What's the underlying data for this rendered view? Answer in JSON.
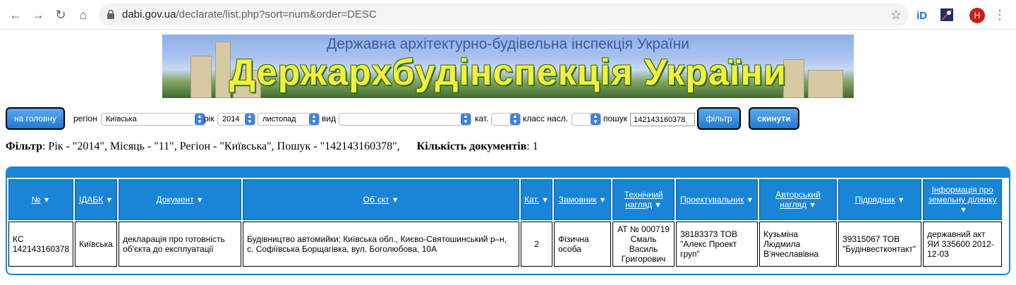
{
  "browser": {
    "url_domain": "dabi.gov.ua",
    "url_path": "/declarate/list.php?sort=num&order=DESC",
    "avatar_letter": "Н"
  },
  "banner": {
    "subtitle": "Державна архітектурно-будівельна інспекція України",
    "title": "Держархбудінспекція України"
  },
  "filter_bar": {
    "home_button": "на головну",
    "region_label": "регіон",
    "region_value": "Київська",
    "year_label": "рік",
    "year_value": "2014",
    "month_value": "листопад",
    "kind_label": "вид",
    "kind_value": "",
    "cat_label": "кат.",
    "cat_value": "",
    "class_label": "класс насл.",
    "class_value": "",
    "search_label": "пошук",
    "search_value": "142143160378",
    "filter_button": "фільтр",
    "reset_button": "скинути"
  },
  "filter_info": {
    "filter_label": "Фільтр",
    "filter_text": ": Рік - \"2014\", Місяць - \"11\", Регіон - \"Київська\", Пошук - \"142143160378\",",
    "count_label": "Кількість документів",
    "count_value": ": 1"
  },
  "table": {
    "headers": [
      "№",
      "ІДАБК",
      "Документ",
      "Об`єкт",
      "Кат.",
      "Замовник",
      "Технічний нагляд",
      "Проектувальник",
      "Авторський нагляд",
      "Підрядник",
      "Інформація про земельну ділянку"
    ],
    "rows": [
      [
        "КС 142143160378",
        "Київська",
        "декларація про готовність об'єкта до експлуатації",
        "Будівництво автомийки; Київська обл., Києво-Святошинський р–н, с. Софіївська Борщагівка, вул. Боголюбова, 10А",
        "2",
        "Фізична особа",
        "АТ № 000719 Смаль Василь Григорович",
        "38183373 ТОВ \"Алекс Проект груп\"",
        "Кузьміна Людмила В'ячеславівна",
        "39315067 ТОВ \"Будінвестконтакт\"",
        "державний акт ЯИ 335600 2012-12-03"
      ]
    ]
  }
}
